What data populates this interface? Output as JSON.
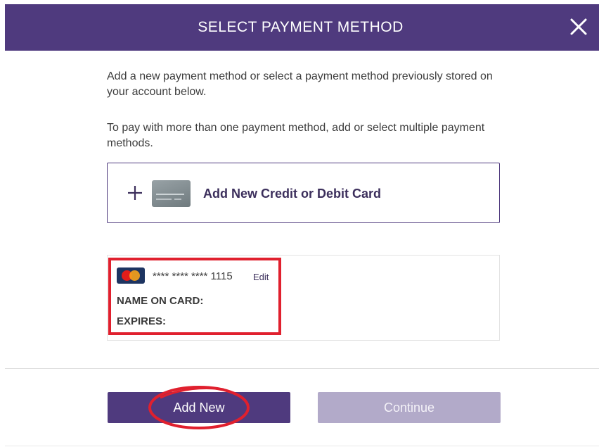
{
  "header": {
    "title": "SELECT PAYMENT METHOD",
    "close_icon": "close-icon"
  },
  "intro": {
    "paragraph1": "Add a new payment method or select a payment method previously stored on your account below.",
    "paragraph2": "To pay with more than one payment method, add or select multiple payment methods."
  },
  "add_card": {
    "label": "Add New Credit or Debit Card",
    "plus_icon": "plus-icon",
    "card_icon": "credit-card-icon"
  },
  "saved_card": {
    "brand_icon": "mastercard-icon",
    "masked_number": "**** **** **** 1115",
    "edit_label": "Edit",
    "name_label": "NAME ON CARD:",
    "expires_label": "EXPIRES:"
  },
  "footer": {
    "add_new_label": "Add New",
    "continue_label": "Continue"
  },
  "colors": {
    "brand": "#4f3a7e",
    "disabled": "#b2aac9",
    "annotation": "#e0202e"
  }
}
